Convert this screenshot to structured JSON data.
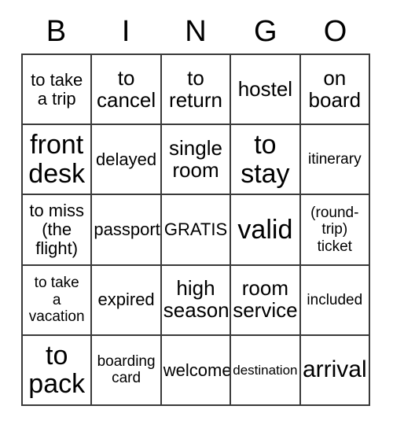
{
  "card": {
    "title": "BINGO",
    "headers": [
      "B",
      "I",
      "N",
      "G",
      "O"
    ],
    "border_color": "#3a3a3a",
    "text_color": "#000000",
    "background_color": "#ffffff",
    "columns": 5,
    "rows": 5,
    "cells": [
      {
        "text": "to take\na trip",
        "size": "fs-md"
      },
      {
        "text": "to\ncancel",
        "size": "fs-lg"
      },
      {
        "text": "to\nreturn",
        "size": "fs-lg"
      },
      {
        "text": "hostel",
        "size": "fs-lg"
      },
      {
        "text": "on\nboard",
        "size": "fs-lg"
      },
      {
        "text": "front\ndesk",
        "size": "fs-xxl"
      },
      {
        "text": "delayed",
        "size": "fs-md"
      },
      {
        "text": "single\nroom",
        "size": "fs-lg"
      },
      {
        "text": "to\nstay",
        "size": "fs-xxl"
      },
      {
        "text": "itinerary",
        "size": "fs-sm"
      },
      {
        "text": "to miss\n(the\nflight)",
        "size": "fs-md"
      },
      {
        "text": "passport",
        "size": "fs-md"
      },
      {
        "text": "GRATIS",
        "size": "fs-md"
      },
      {
        "text": "valid",
        "size": "fs-xxl"
      },
      {
        "text": "(round-\ntrip)\nticket",
        "size": "fs-sm"
      },
      {
        "text": "to take\na\nvacation",
        "size": "fs-sm"
      },
      {
        "text": "expired",
        "size": "fs-md"
      },
      {
        "text": "high\nseason",
        "size": "fs-lg"
      },
      {
        "text": "room\nservice",
        "size": "fs-lg"
      },
      {
        "text": "included",
        "size": "fs-sm"
      },
      {
        "text": "to\npack",
        "size": "fs-xxl"
      },
      {
        "text": "boarding\ncard",
        "size": "fs-sm"
      },
      {
        "text": "welcome",
        "size": "fs-md"
      },
      {
        "text": "destination",
        "size": "fs-xs"
      },
      {
        "text": "arrival",
        "size": "fs-xl"
      }
    ]
  }
}
